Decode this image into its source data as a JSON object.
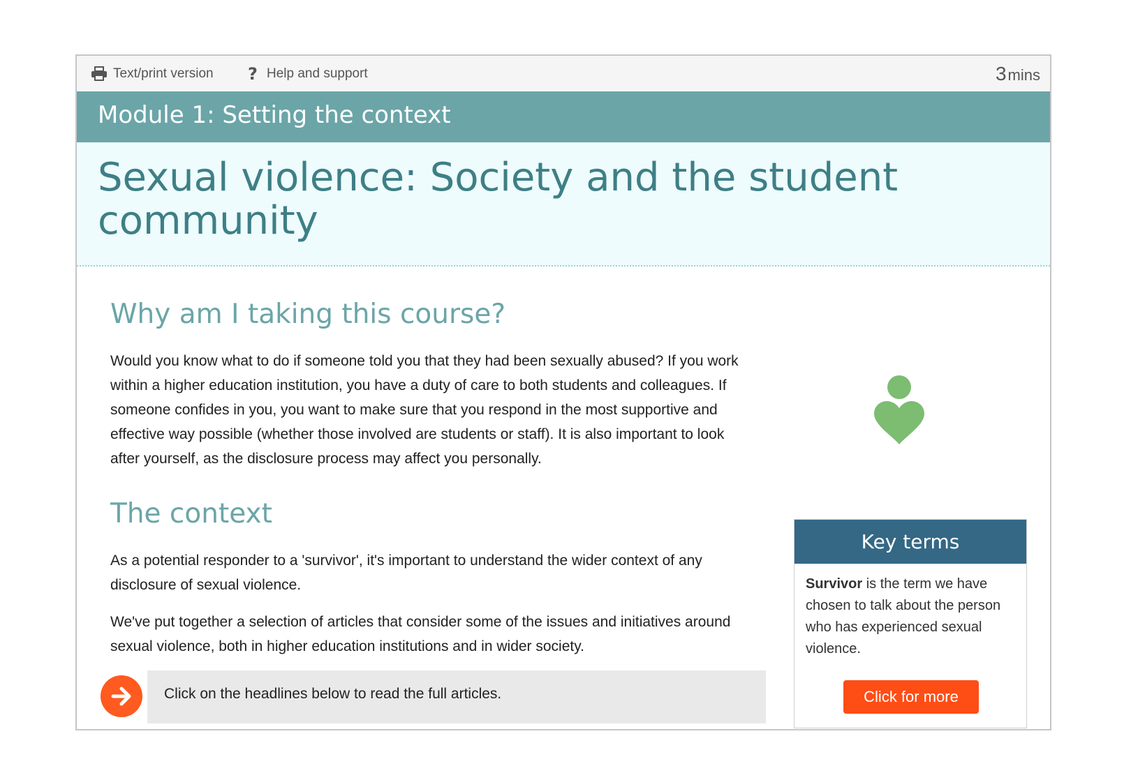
{
  "toolbar": {
    "print_label": "Text/print version",
    "help_label": "Help and support",
    "duration_value": "3",
    "duration_unit": "mins"
  },
  "module": {
    "title": "Module 1: Setting the context"
  },
  "page": {
    "title": "Sexual violence: Society and the student community"
  },
  "sections": {
    "why": {
      "heading": "Why am I taking this course?",
      "body": "Would you know what to do if someone told you that they had been sexually abused? If you work within a higher education institution, you have a duty of care to both students and colleagues. If someone confides in you, you want to make sure that you respond in the most supportive and effective way possible (whether those involved are students or staff). It is also important to look after yourself, as the disclosure process may affect you personally."
    },
    "context": {
      "heading": "The context",
      "body1": "As a potential responder to a 'survivor', it's important to understand the wider context of any disclosure of sexual violence.",
      "body2": "We've put together a selection of articles that consider some of the issues and initiatives around sexual violence, both in higher education institutions and in wider society."
    }
  },
  "cta": {
    "text": "Click on the headlines below to read the full articles."
  },
  "key_terms": {
    "title": "Key terms",
    "term": "Survivor",
    "definition": " is the term we have chosen to talk about the person who has experienced sexual violence.",
    "button_label": "Click for more"
  },
  "icons": [
    "printer-icon",
    "help-icon",
    "heart-person-icon",
    "arrow-right-icon"
  ],
  "colors": {
    "module_bar": "#6ba5a8",
    "title_band": "#eefcfd",
    "title_text": "#3e7f86",
    "heading_text": "#6ba5a8",
    "key_header": "#346885",
    "accent_orange": "#ff4d16",
    "heart_green": "#7cbd72"
  }
}
